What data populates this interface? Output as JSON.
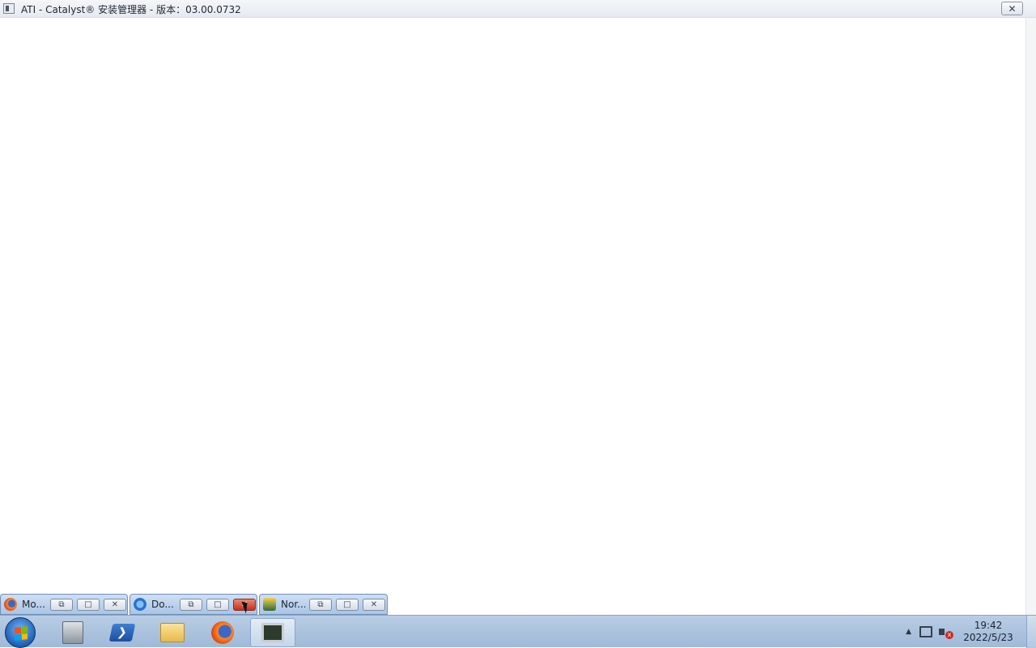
{
  "window": {
    "title": "ATI - Catalyst® 安装管理器 - 版本：03.00.0732",
    "close_label": "✕"
  },
  "minimized_windows": [
    {
      "label": "Mo...",
      "icon": "firefox-icon"
    },
    {
      "label": "Do...",
      "icon": "internet-explorer-icon"
    },
    {
      "label": "Nor...",
      "icon": "shield-app-icon"
    }
  ],
  "window_buttons": {
    "restore": "⧉",
    "maximize": "□",
    "close": "✕"
  },
  "taskbar": {
    "pinned": [
      "server-manager-icon",
      "powershell-icon",
      "file-explorer-icon",
      "firefox-icon",
      "monitor-app-icon"
    ],
    "powershell_glyph": "❯"
  },
  "tray": {
    "overflow_arrow": "▲",
    "volume_muted_glyph": "x",
    "time": "19:42",
    "date": "2022/5/23"
  }
}
